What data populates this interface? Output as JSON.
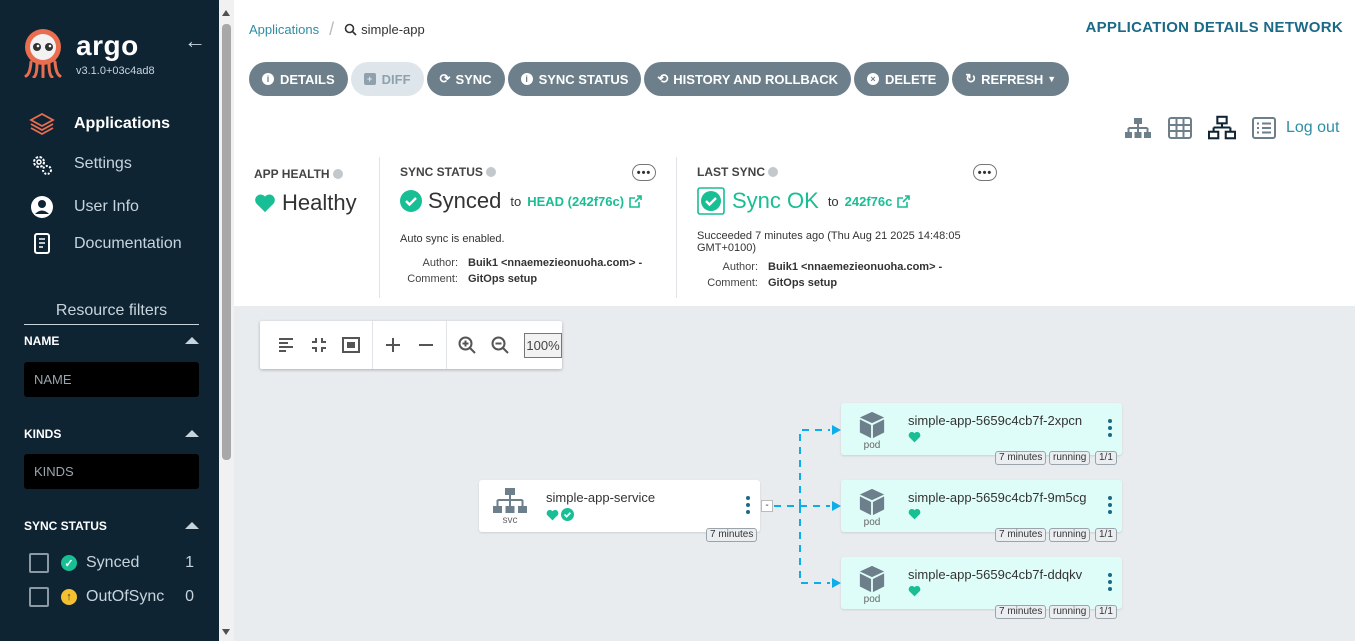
{
  "sidebar": {
    "brand": "argo",
    "version": "v3.1.0+03c4ad8",
    "nav": [
      {
        "label": "Applications",
        "icon": "layers-icon",
        "active": true
      },
      {
        "label": "Settings",
        "icon": "gears-icon",
        "active": false
      },
      {
        "label": "User Info",
        "icon": "user-circle-icon",
        "active": false
      },
      {
        "label": "Documentation",
        "icon": "book-icon",
        "active": false
      }
    ],
    "resource_filters_title": "Resource filters",
    "filters": {
      "name": {
        "label": "NAME",
        "placeholder": "NAME"
      },
      "kinds": {
        "label": "KINDS",
        "placeholder": "KINDS"
      },
      "sync_status": {
        "label": "SYNC STATUS",
        "options": [
          {
            "label": "Synced",
            "count": "1",
            "color": "#18be94",
            "checked": false
          },
          {
            "label": "OutOfSync",
            "count": "0",
            "color": "#f4c030",
            "checked": false
          }
        ]
      }
    }
  },
  "header": {
    "breadcrumb_root": "Applications",
    "breadcrumb_current": "simple-app",
    "page_title": "APPLICATION DETAILS NETWORK"
  },
  "toolbar": {
    "details": "DETAILS",
    "diff": "DIFF",
    "sync": "SYNC",
    "sync_status": "SYNC STATUS",
    "history": "HISTORY AND ROLLBACK",
    "delete": "DELETE",
    "refresh": "REFRESH"
  },
  "view": {
    "logout": "Log out"
  },
  "app_health": {
    "label": "APP HEALTH",
    "value": "Healthy"
  },
  "sync_status": {
    "label": "SYNC STATUS",
    "value": "Synced",
    "to": "to",
    "revision": "HEAD (242f76c)",
    "auto_sync": "Auto sync is enabled.",
    "author_label": "Author:",
    "author": "Buik1 <nnaemezieonuoha.com> -",
    "comment_label": "Comment:",
    "comment": "GitOps setup"
  },
  "last_sync": {
    "label": "LAST SYNC",
    "value": "Sync OK",
    "to": "to",
    "revision": "242f76c",
    "succeeded": "Succeeded 7 minutes ago (Thu Aug 21 2025 14:48:05 GMT+0100)",
    "author_label": "Author:",
    "author": "Buik1 <nnaemezieonuoha.com> -",
    "comment_label": "Comment:",
    "comment": "GitOps setup"
  },
  "graph": {
    "zoom": "100%",
    "service": {
      "name": "simple-app-service",
      "type": "svc",
      "age": "7 minutes"
    },
    "pods": [
      {
        "name": "simple-app-5659c4cb7f-2xpcn",
        "type": "pod",
        "age": "7 minutes",
        "status": "running",
        "ready": "1/1"
      },
      {
        "name": "simple-app-5659c4cb7f-9m5cg",
        "type": "pod",
        "age": "7 minutes",
        "status": "running",
        "ready": "1/1"
      },
      {
        "name": "simple-app-5659c4cb7f-ddqkv",
        "type": "pod",
        "age": "7 minutes",
        "status": "running",
        "ready": "1/1"
      }
    ]
  },
  "colors": {
    "sidebar_bg": "#0e2433",
    "accent": "#2d8ea5",
    "healthy": "#18be94",
    "button": "#6d7f8b",
    "edge": "#0dadea"
  }
}
